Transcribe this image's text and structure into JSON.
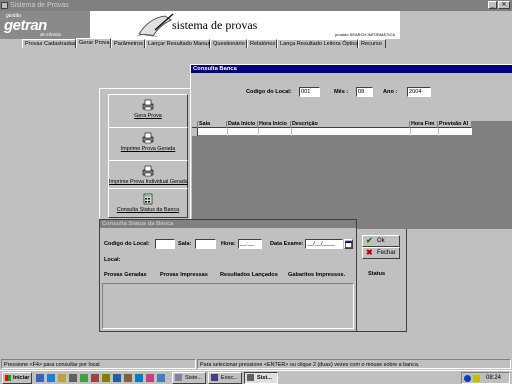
{
  "window": {
    "title": "Sistema de Provas"
  },
  "banner": {
    "logo_top": "gestão",
    "logo_main": "getran",
    "logo_sub": "de trânsito",
    "app_name": "sistema de provas",
    "credit": "produto SEARCH INFORMÁTICA"
  },
  "tabs": [
    {
      "label": "Provas Cadastradas"
    },
    {
      "label": "Gerar Prova"
    },
    {
      "label": "Parâmetros"
    },
    {
      "label": "Lançar Resultado Manual"
    },
    {
      "label": "Questionário"
    },
    {
      "label": "Relatórios"
    },
    {
      "label": "Lança Resultado Leitora Óptica"
    },
    {
      "label": "Recurso"
    }
  ],
  "menu": {
    "gera_prova": "Gera Prova",
    "imprime_prova": "Imprime Prova Gerada",
    "imprime_individual": "Imprime Prova Individual Gerada",
    "consulta_status": "Consulta Status da Banca"
  },
  "consulta_banca": {
    "title": "Consulta Banca",
    "codigo_label": "Codigo do Local:",
    "codigo_value": "001",
    "mes_label": "Mês :",
    "mes_value": "08",
    "ano_label": "Ano :",
    "ano_value": "2004",
    "columns": [
      "Sala",
      "Data Inicio",
      "Hora Inicio",
      "Descrição",
      "Hora Fim",
      "Previsão Al"
    ]
  },
  "status_banca": {
    "title": "Consulta Status da Banca",
    "codigo_label": "Codigo do Local:",
    "sala_label": "Sala:",
    "hora_label": "Hora:",
    "hora_value": "__:__",
    "data_label": "Data Exame:",
    "data_value": "__/__/____",
    "local_label": "Local:",
    "ok_label": "Ok",
    "fechar_label": "Fechar",
    "columns": [
      "Provas Geradas",
      "Provas Impressas",
      "Resultados Lançados",
      "Gabaritos Impressos.",
      "Status"
    ]
  },
  "statusbar": {
    "left": "Pressione <F4> para consultar por local",
    "right": "Para selecionar pressione <ENTER> ou clique 2 (duas) vezes com o mouse sobre a banca."
  },
  "taskbar": {
    "start": "Iniciar",
    "tasks": [
      "Siste...",
      "Exec...",
      "Sist..."
    ],
    "clock": "08:24"
  },
  "colors": {
    "title_blue": "#000080",
    "face": "#c0c0c0",
    "desktop": "#808080"
  }
}
